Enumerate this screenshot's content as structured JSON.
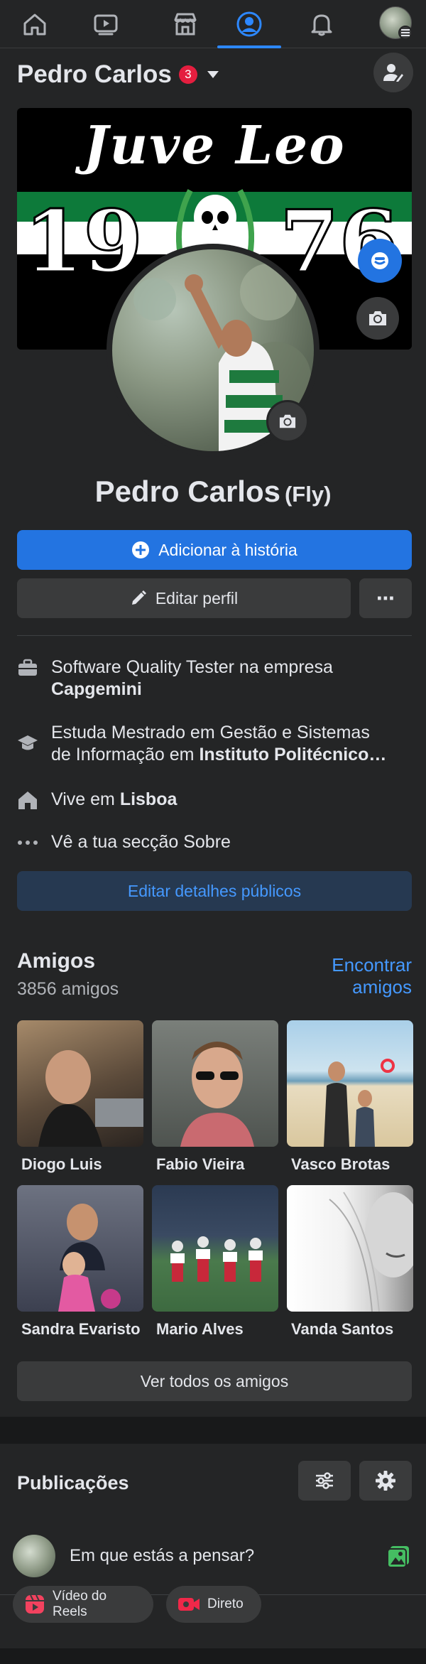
{
  "nav": {
    "items": [
      "home-icon",
      "video-icon",
      "marketplace-icon",
      "profile-icon",
      "notifications-icon",
      "menu-avatar"
    ],
    "active": "profile-icon"
  },
  "profile": {
    "name": "Pedro Carlos",
    "notification_count": "3",
    "alt_name": "(Fly)",
    "cover_title": "Juve Leo",
    "cover_year_left": "19",
    "cover_year_right": "76"
  },
  "actions": {
    "add_story": "Adicionar à história",
    "edit_profile": "Editar perfil",
    "more": "⋯"
  },
  "details": {
    "work_prefix": "Software Quality Tester na empresa",
    "work_company": "Capgemini",
    "study_prefix": "Estuda Mestrado em Gestão e Sistemas",
    "study_line2_prefix": "de Informação em",
    "study_school": "Instituto Politécnico…",
    "lives_prefix": "Vive em",
    "lives_city": "Lisboa",
    "about_link": "Vê a tua secção Sobre",
    "edit_public": "Editar detalhes públicos"
  },
  "friends": {
    "title": "Amigos",
    "count": "3856 amigos",
    "find_line1": "Encontrar",
    "find_line2": "amigos",
    "list": [
      {
        "name": "Diogo Luis"
      },
      {
        "name": "Fabio Vieira"
      },
      {
        "name": "Vasco Brotas"
      },
      {
        "name": "Sandra Evaristo"
      },
      {
        "name": "Mario Alves"
      },
      {
        "name": "Vanda Santos"
      }
    ],
    "see_all": "Ver todos os amigos"
  },
  "posts": {
    "title": "Publicações",
    "composer_placeholder": "Em que estás a pensar?",
    "reels_line1": "Vídeo do",
    "reels_line2": "Reels",
    "live": "Direto"
  },
  "colors": {
    "accent": "#2374e1",
    "link": "#4599ff",
    "background": "#242526",
    "badge": "#e41e3f"
  }
}
